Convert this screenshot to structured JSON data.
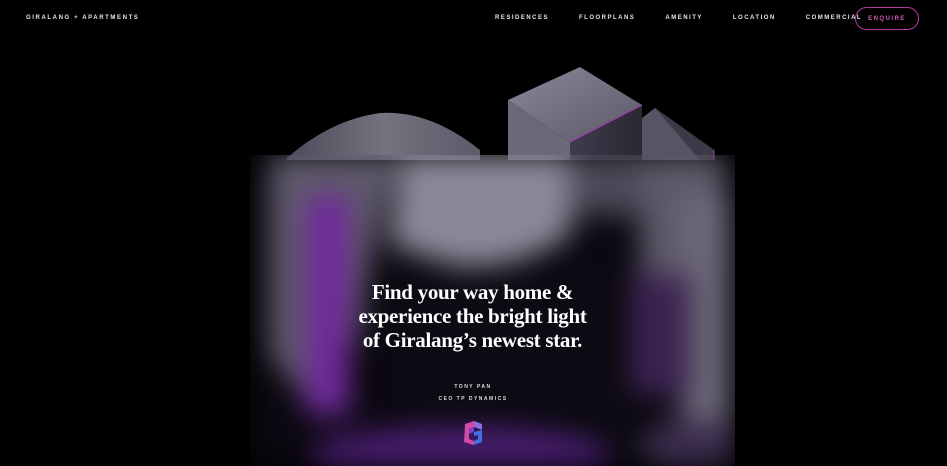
{
  "header": {
    "brand": "GIRALANG + APARTMENTS",
    "nav": [
      "RESIDENCES",
      "FLOORPLANS",
      "AMENITY",
      "LOCATION",
      "COMMERCIAL"
    ],
    "cta": "ENQUIRE"
  },
  "hero": {
    "quote_lines": [
      "Find your way home &",
      "experience the bright light",
      "of Giralang’s newest star."
    ],
    "author_name": "TONY PAN",
    "author_role": "CEO TP DYNAMICS"
  },
  "colors": {
    "background": "#000000",
    "accent": "#d257b6",
    "building": "#5e5b6c",
    "glow": "#7a2fa6"
  },
  "icons": [
    "giralang-logo-icon"
  ]
}
